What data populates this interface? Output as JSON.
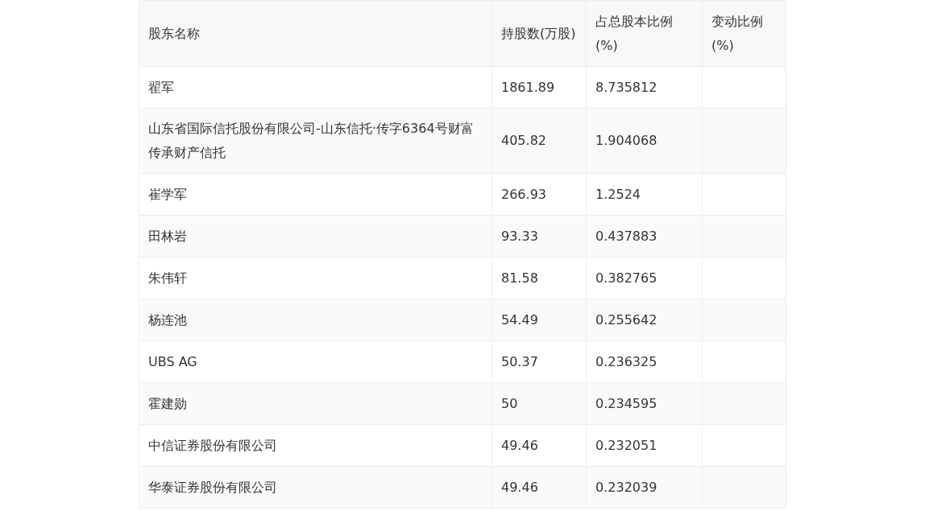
{
  "table": {
    "columns": [
      "股东名称",
      "持股数(万股)",
      "占总股本比例(%)",
      "变动比例(%)"
    ],
    "rows": [
      [
        "翟军",
        "1861.89",
        "8.735812",
        ""
      ],
      [
        "山东省国际信托股份有限公司-山东信托·传字6364号财富传承财产信托",
        "405.82",
        "1.904068",
        ""
      ],
      [
        "崔学军",
        "266.93",
        "1.2524",
        ""
      ],
      [
        "田林岩",
        "93.33",
        "0.437883",
        ""
      ],
      [
        "朱伟轩",
        "81.58",
        "0.382765",
        ""
      ],
      [
        "杨连池",
        "54.49",
        "0.255642",
        ""
      ],
      [
        "UBS AG",
        "50.37",
        "0.236325",
        ""
      ],
      [
        "霍建勋",
        "50",
        "0.234595",
        ""
      ],
      [
        "中信证券股份有限公司",
        "49.46",
        "0.232051",
        ""
      ],
      [
        "华泰证券股份有限公司",
        "49.46",
        "0.232039",
        ""
      ]
    ]
  }
}
